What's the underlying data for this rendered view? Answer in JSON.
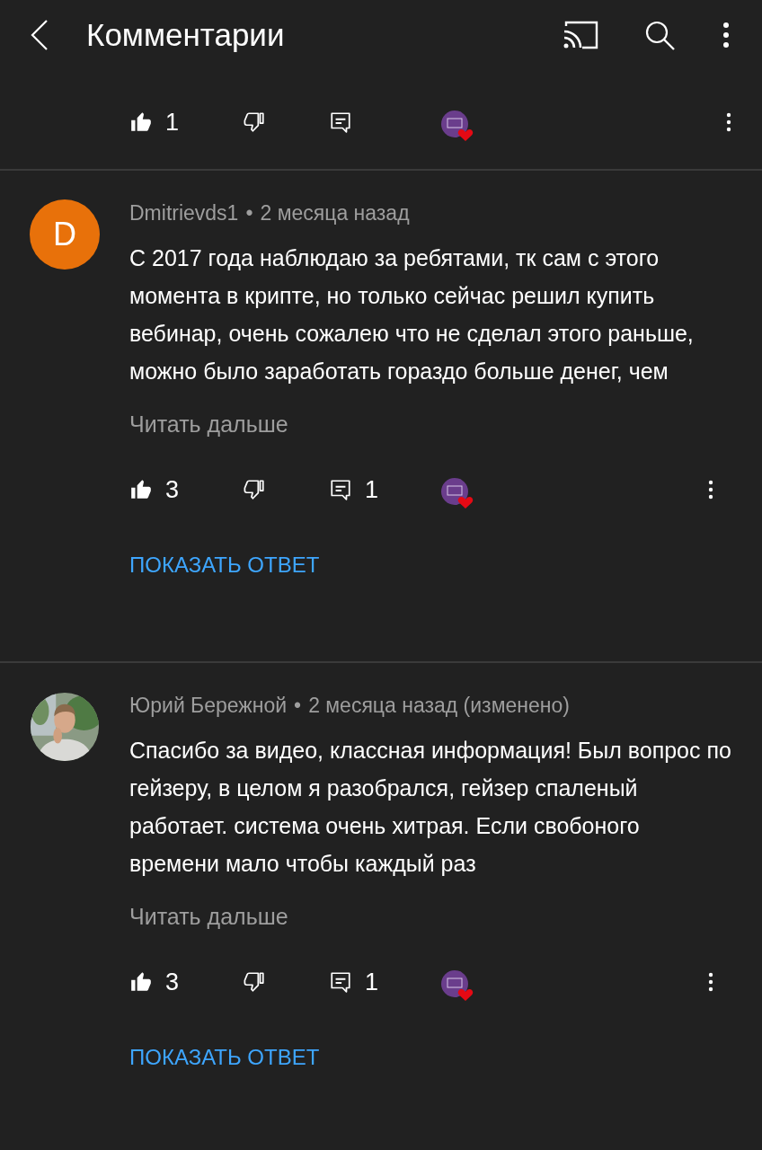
{
  "header": {
    "title": "Комментарии"
  },
  "top_actions": {
    "likes": "1",
    "liked": true,
    "hearted": true
  },
  "comments": [
    {
      "author": "Dmitrievds1",
      "separator": "•",
      "time": "2 месяца назад",
      "avatar": {
        "kind": "letter",
        "letter": "D",
        "color": "#e8710a"
      },
      "text": "С 2017 года наблюдаю за ребятами, тк сам с этого момента в крипте, но только сейчас решил купить вебинар, очень сожалею что не сделал этого раньше, можно было заработать гораздо больше денег, чем",
      "read_more": "Читать дальше",
      "likes": "3",
      "liked": true,
      "replies": "1",
      "hearted": true,
      "show_reply": "ПОКАЗАТЬ ОТВЕТ"
    },
    {
      "author": "Юрий Бережной",
      "separator": "•",
      "time": "2 месяца назад (изменено)",
      "text": "Спасибо за видео, классная информация! Был вопрос по гейзеру, в целом я разобрался, гейзер спаленый работает. система очень хитрая. Если свобоного времени мало чтобы каждый раз",
      "read_more": "Читать дальше",
      "likes": "3",
      "liked": true,
      "replies": "1",
      "hearted": true,
      "show_reply": "ПОКАЗАТЬ ОТВЕТ"
    }
  ]
}
